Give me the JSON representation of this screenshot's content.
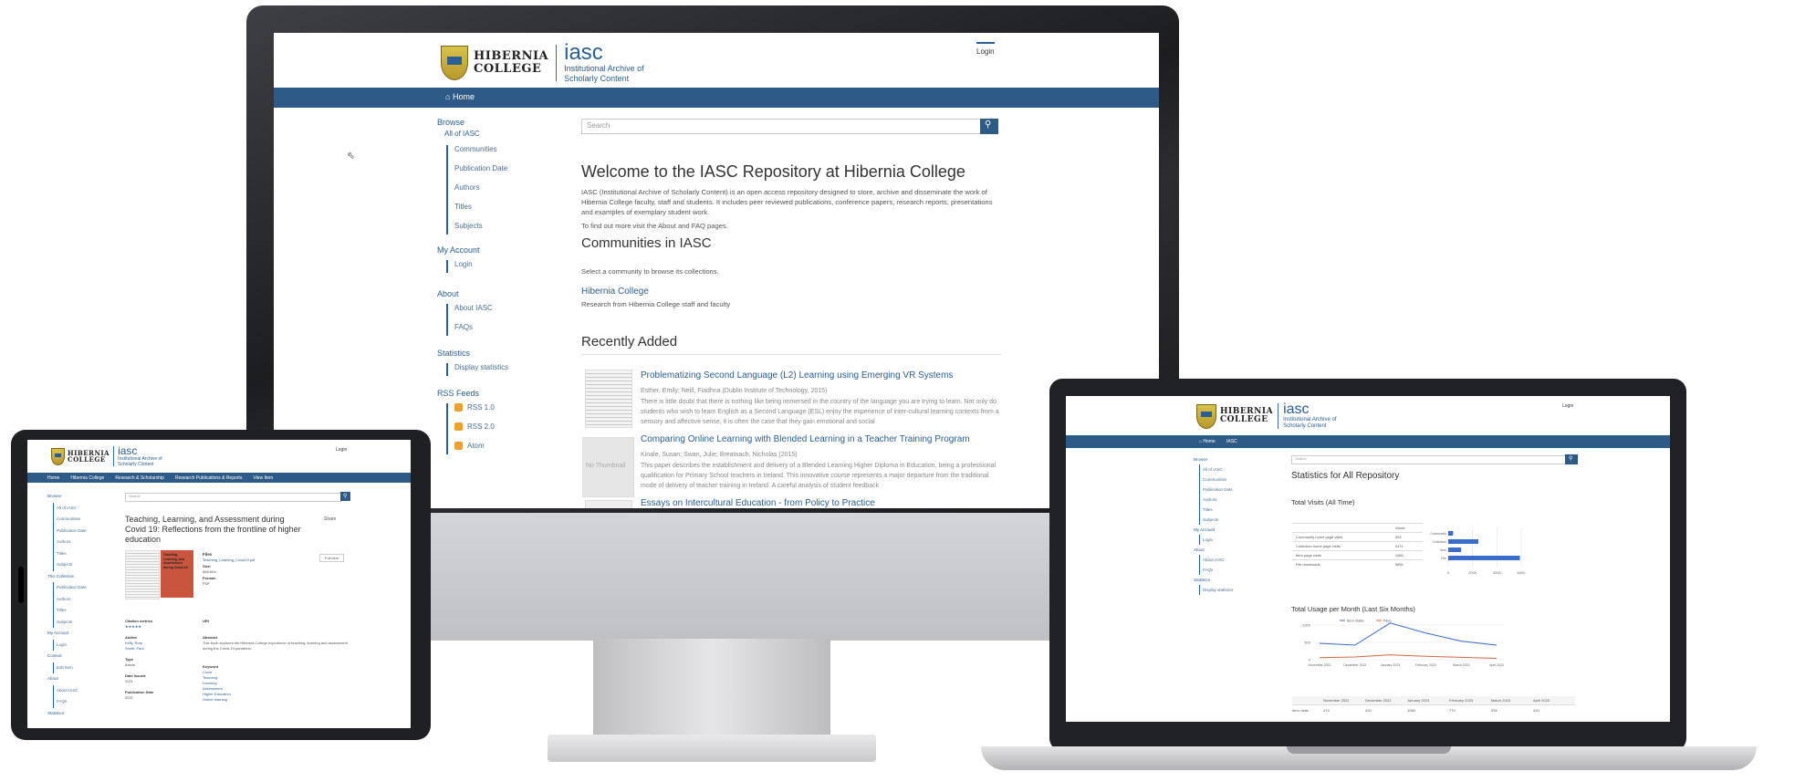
{
  "brand": {
    "name_line1": "HIBERNIA",
    "name_line2": "COLLEGE",
    "acronym": "iasc",
    "subtitle_line1": "Institutional Archive of",
    "subtitle_line2": "Scholarly Content"
  },
  "desktop": {
    "login": "Login",
    "nav_home": "Home",
    "search_placeholder": "Search",
    "sidebar": {
      "browse_heading": "Browse",
      "browse_all": "All of IASC",
      "browse_items": [
        "Communities",
        "Publication Date",
        "Authors",
        "Titles",
        "Subjects"
      ],
      "account_heading": "My Account",
      "account_items": [
        "Login"
      ],
      "about_heading": "About",
      "about_items": [
        "About IASC",
        "FAQs"
      ],
      "stats_heading": "Statistics",
      "stats_items": [
        "Display statistics"
      ],
      "rss_heading": "RSS Feeds",
      "rss_items": [
        "RSS 1.0",
        "RSS 2.0",
        "Atom"
      ]
    },
    "welcome_title": "Welcome to the IASC Repository at Hibernia College",
    "welcome_body": "IASC (Institutional Archive of Scholarly Content) is an open access repository designed to store, archive and disseminate the work of Hibernia College faculty, staff and students. It includes peer reviewed publications, conference papers, research reports, presentations and examples of exemplary student work.",
    "welcome_more": "To find out more visit the About and FAQ pages.",
    "communities_title": "Communities in IASC",
    "communities_hint": "Select a community to browse its collections.",
    "community_name": "Hibernia College",
    "community_desc": "Research from Hibernia College staff and faculty",
    "recent_title": "Recently Added",
    "recent": [
      {
        "title": "Problematizing Second Language (L2) Learning using Emerging VR Systems",
        "authors": "Esther, Emily; Neill, Fiadhna (Dublin Institute of Technology, 2015)",
        "abstract": "There is little doubt that there is nothing like being immersed in the country of the language you are trying to learn. Not only do students who wish to learn English as a Second Language (ESL) enjoy the experience of inter-cultural learning contexts from a sensory and affective sense, it is often the case that they gain emotional and social"
      },
      {
        "title": "Comparing Online Learning with Blended Learning in a Teacher Training Program",
        "authors": "Kinale, Susan; Swan, Julie; Breatnach, Nicholas (2015)",
        "abstract": "This paper describes the establishment and delivery of a Blended Learning Higher Diploma in Education, being a professional qualification for Primary School teachers in Ireland. This innovative course represents a major departure from the traditional mode of delivery of teacher training in Ireland. A careful analysis of student feedback",
        "thumb": "No Thumbnail"
      },
      {
        "title": "Essays on Intercultural Education - from Policy to Practice"
      }
    ]
  },
  "tablet": {
    "login": "Login",
    "nav": [
      "Home",
      "Hibernia College",
      "Research & Scholarship",
      "Research Publications & Reports",
      "View Item"
    ],
    "search_placeholder": "Search",
    "item_title": "Teaching, Learning, and Assessment during Covid 19: Reflections from the frontline of higher education",
    "share": "Share",
    "item_cover_title": "Teaching, Learning, and Assessment during Covid-19",
    "full_record": "Full item",
    "files_heading": "Files",
    "filename": "Teaching_Learning_Covid19.pdf",
    "size_label": "Size:",
    "size_value": "868.6Kb",
    "format_label": "Format:",
    "format_value": "PDF",
    "altmetric_heading": "Citation metrics",
    "author_heading": "Author",
    "authors": [
      "Kelly, Rory",
      "Smith, Paul"
    ],
    "type_heading": "Type",
    "type_value": "Article",
    "date_heading": "Date Issued",
    "date_value": "2021",
    "pub_heading": "Publication Date",
    "pub_value": "2021",
    "uri_heading": "URI",
    "abstract_heading": "Abstract",
    "abstract": "This book explores the Hibernia College experience of teaching, learning and assessment during the Covid-19 pandemic.",
    "keywords_heading": "Keyword",
    "keywords": [
      "Covid",
      "Teaching",
      "Learning",
      "Assessment",
      "Higher Education",
      "Online learning"
    ],
    "sidebar_items": [
      "Browse",
      "All of IASC",
      "Communities",
      "Publication Date",
      "Authors",
      "Titles",
      "Subjects",
      "This Collection",
      "Publication Date",
      "Authors",
      "Titles",
      "Subjects",
      "My Account",
      "Login",
      "Context",
      "Edit Item",
      "About",
      "About IASC",
      "FAQs",
      "Statistics"
    ]
  },
  "laptop": {
    "login": "Login",
    "nav": [
      "Home",
      "IASC"
    ],
    "search_placeholder": "Search",
    "stats_title": "Statistics for All Repository",
    "visits_title": "Total Visits (All Time)",
    "visits_col": "Views",
    "visits_rows": [
      {
        "label": "Community home page visits",
        "value": "403"
      },
      {
        "label": "Collection home page visits",
        "value": "2471"
      },
      {
        "label": "Item page visits",
        "value": "1060"
      },
      {
        "label": "File downloads",
        "value": "5890"
      }
    ],
    "bar_ticks": [
      "0",
      "2000",
      "4000",
      "6000"
    ],
    "usage_title": "Total Usage per Month (Last Six Months)",
    "legend": [
      "Item Visits",
      "Files"
    ],
    "months": [
      "November 2022",
      "December 2022",
      "January 2023",
      "February 2023",
      "March 2023",
      "April 2023"
    ],
    "row_label": "Item visits",
    "row_values": [
      "474",
      "420",
      "1060",
      "770",
      "535",
      "420"
    ],
    "y_ticks": [
      "1000",
      "500",
      "0"
    ],
    "sidebar_items": [
      "Browse",
      "All of IASC",
      "Communities",
      "Publication Date",
      "Authors",
      "Titles",
      "Subjects",
      "My Account",
      "Login",
      "About",
      "About IASC",
      "FAQs",
      "Statistics",
      "Display statistics"
    ]
  },
  "colors": {
    "nav_blue": "#2d5a87",
    "link_blue": "#2a5f94",
    "rss_orange": "#f0a030",
    "bezel": "#1e1f22"
  },
  "chart_data": [
    {
      "type": "bar",
      "categories": [
        "Community home page visits",
        "Collection home page visits",
        "Item page visits",
        "File downloads"
      ],
      "values": [
        403,
        2471,
        1060,
        5890
      ],
      "xlim": [
        0,
        6000
      ]
    },
    {
      "type": "line",
      "categories": [
        "November 2022",
        "December 2022",
        "January 2023",
        "February 2023",
        "March 2023",
        "April 2023"
      ],
      "series": [
        {
          "name": "Item Visits",
          "values": [
            474,
            420,
            1060,
            770,
            535,
            420
          ]
        },
        {
          "name": "Files",
          "values": [
            60,
            80,
            140,
            100,
            70,
            40
          ]
        }
      ],
      "ylim": [
        0,
        1000
      ]
    }
  ]
}
